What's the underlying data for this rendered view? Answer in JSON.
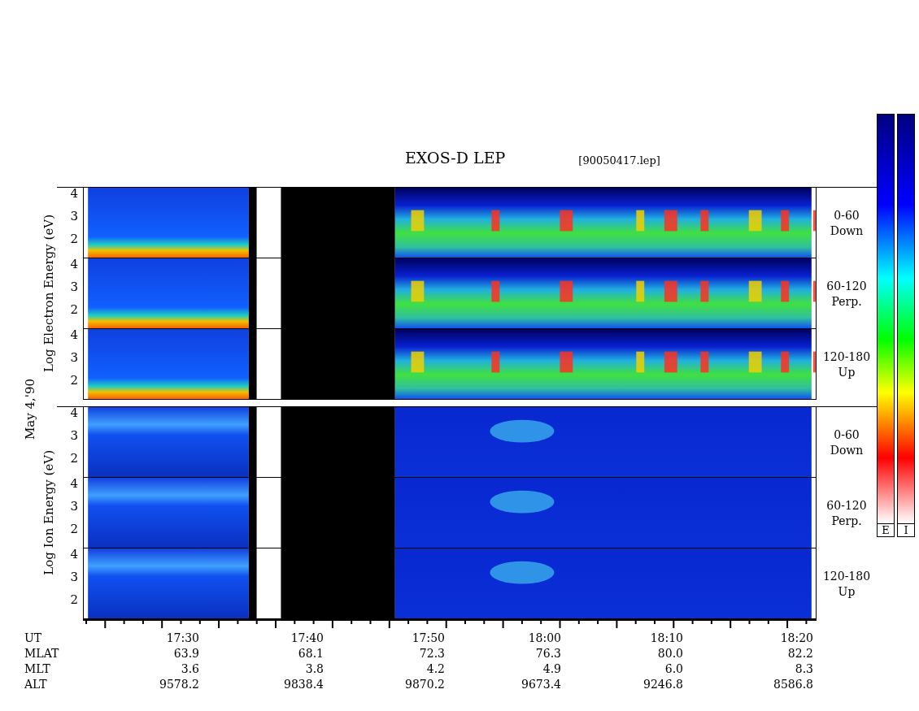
{
  "title": "EXOS-D LEP",
  "file": "[90050417.lep]",
  "groups": [
    {
      "kind": "electron",
      "axis_title": "Log Electron Energy (eV)",
      "panels": [
        {
          "ticks": [
            "4",
            "3",
            "2"
          ],
          "angle": "0-60",
          "direction": "Down"
        },
        {
          "ticks": [
            "4",
            "3",
            "2"
          ],
          "angle": "60-120",
          "direction": "Perp."
        },
        {
          "ticks": [
            "4",
            "3",
            "2"
          ],
          "angle": "120-180",
          "direction": "Up"
        }
      ]
    },
    {
      "kind": "ion",
      "axis_title": "Log Ion Energy (eV)",
      "panels": [
        {
          "ticks": [
            "4",
            "3",
            "2"
          ],
          "angle": "0-60",
          "direction": "Down"
        },
        {
          "ticks": [
            "4",
            "3",
            "2"
          ],
          "angle": "60-120",
          "direction": "Perp."
        },
        {
          "ticks": [
            "4",
            "3",
            "2"
          ],
          "angle": "120-180",
          "direction": "Up"
        }
      ]
    }
  ],
  "date": "May 4,'90",
  "ephemeris": [
    {
      "label": "UT",
      "values": [
        "17:30",
        "17:40",
        "17:50",
        "18:00",
        "18:10",
        "18:20"
      ]
    },
    {
      "label": "MLAT",
      "values": [
        "63.9",
        "68.1",
        "72.3",
        "76.3",
        "80.0",
        "82.2"
      ]
    },
    {
      "label": "MLT",
      "values": [
        "3.6",
        "3.8",
        "4.2",
        "4.9",
        "6.0",
        "8.3"
      ]
    },
    {
      "label": "ALT",
      "values": [
        "9578.2",
        "9838.4",
        "9870.2",
        "9673.4",
        "9246.8",
        "8586.8"
      ]
    }
  ],
  "color_scales": [
    {
      "label": "E"
    },
    {
      "label": "I"
    }
  ]
}
